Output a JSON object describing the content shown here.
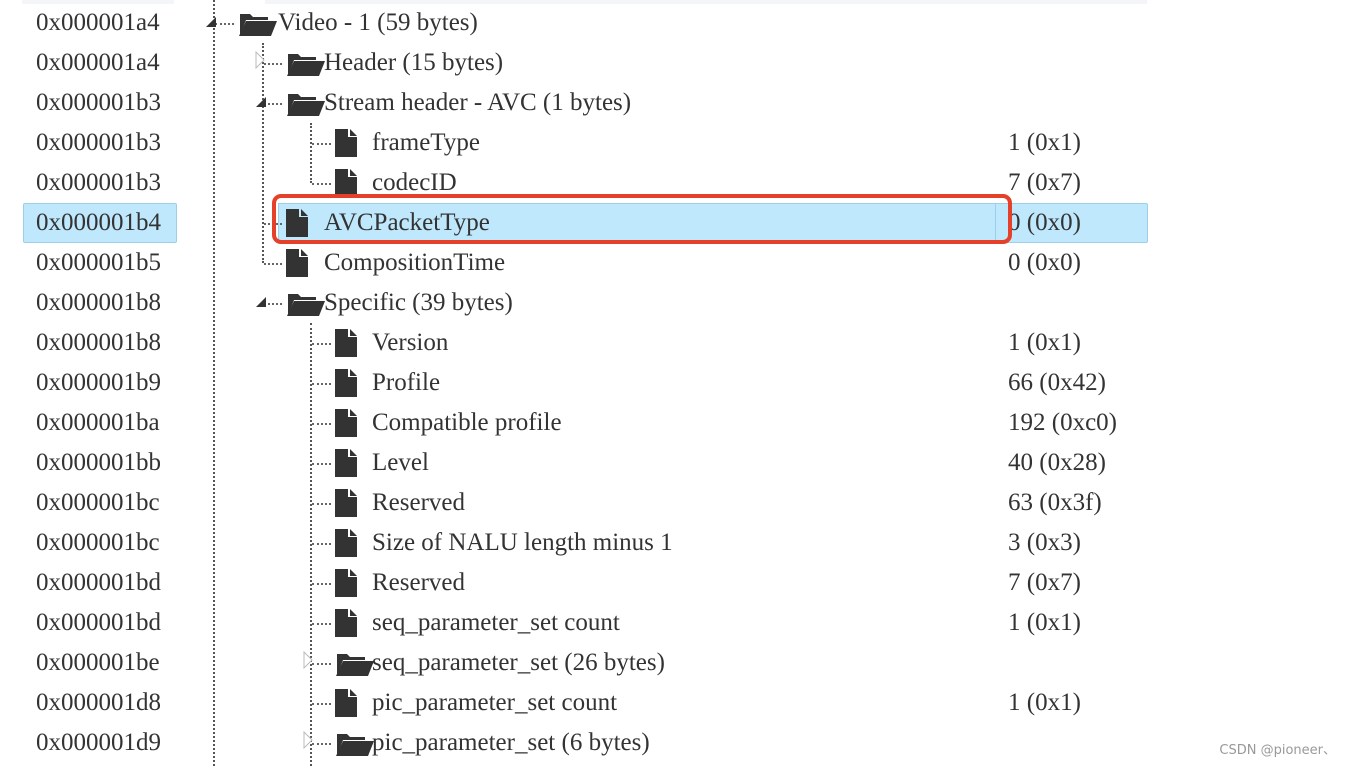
{
  "rows": [
    {
      "offset": "0x000001a4",
      "level": 0,
      "type": "folder-open",
      "expander": "expanded",
      "name": "Video - 1 (59 bytes)",
      "value": ""
    },
    {
      "offset": "0x000001a4",
      "level": 1,
      "type": "folder-open",
      "expander": "collapsed",
      "name": "Header (15 bytes)",
      "value": ""
    },
    {
      "offset": "0x000001b3",
      "level": 1,
      "type": "folder-open",
      "expander": "expanded",
      "name": "Stream header - AVC (1 bytes)",
      "value": ""
    },
    {
      "offset": "0x000001b3",
      "level": 2,
      "type": "file",
      "expander": "none",
      "name": "frameType",
      "value": "1 (0x1)"
    },
    {
      "offset": "0x000001b3",
      "level": 2,
      "type": "file",
      "expander": "none",
      "name": "codecID",
      "value": "7 (0x7)"
    },
    {
      "offset": "0x000001b4",
      "level": 1,
      "type": "file",
      "expander": "none",
      "name": "AVCPacketType",
      "value": "0 (0x0)",
      "selected": true
    },
    {
      "offset": "0x000001b5",
      "level": 1,
      "type": "file",
      "expander": "none",
      "name": "CompositionTime",
      "value": "0 (0x0)"
    },
    {
      "offset": "0x000001b8",
      "level": 1,
      "type": "folder-open",
      "expander": "expanded",
      "name": "Specific (39 bytes)",
      "value": ""
    },
    {
      "offset": "0x000001b8",
      "level": 2,
      "type": "file",
      "expander": "none",
      "name": "Version",
      "value": "1 (0x1)"
    },
    {
      "offset": "0x000001b9",
      "level": 2,
      "type": "file",
      "expander": "none",
      "name": "Profile",
      "value": "66 (0x42)"
    },
    {
      "offset": "0x000001ba",
      "level": 2,
      "type": "file",
      "expander": "none",
      "name": "Compatible profile",
      "value": "192 (0xc0)"
    },
    {
      "offset": "0x000001bb",
      "level": 2,
      "type": "file",
      "expander": "none",
      "name": "Level",
      "value": "40 (0x28)"
    },
    {
      "offset": "0x000001bc",
      "level": 2,
      "type": "file",
      "expander": "none",
      "name": "Reserved",
      "value": "63 (0x3f)"
    },
    {
      "offset": "0x000001bc",
      "level": 2,
      "type": "file",
      "expander": "none",
      "name": "Size of NALU length minus 1",
      "value": "3 (0x3)"
    },
    {
      "offset": "0x000001bd",
      "level": 2,
      "type": "file",
      "expander": "none",
      "name": "Reserved",
      "value": "7 (0x7)"
    },
    {
      "offset": "0x000001bd",
      "level": 2,
      "type": "file",
      "expander": "none",
      "name": "seq_parameter_set count",
      "value": "1 (0x1)"
    },
    {
      "offset": "0x000001be",
      "level": 2,
      "type": "folder-open",
      "expander": "collapsed",
      "name": "seq_parameter_set (26 bytes)",
      "value": ""
    },
    {
      "offset": "0x000001d8",
      "level": 2,
      "type": "file",
      "expander": "none",
      "name": "pic_parameter_set count",
      "value": "1 (0x1)"
    },
    {
      "offset": "0x000001d9",
      "level": 2,
      "type": "folder-open",
      "expander": "collapsed",
      "name": "pic_parameter_set (6 bytes)",
      "value": ""
    }
  ],
  "colors": {
    "selection": "#bfe8fc",
    "highlight_box": "#e5402a",
    "text": "#333333"
  },
  "watermark": "CSDN @pioneer、"
}
